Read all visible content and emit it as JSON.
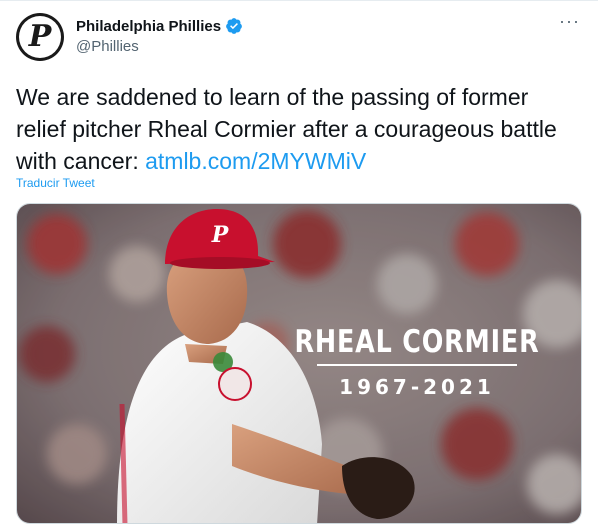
{
  "account": {
    "display_name": "Philadelphia Phillies",
    "handle": "@Phillies",
    "avatar_letter": "P",
    "verified": true
  },
  "tweet": {
    "text": "We are saddened to learn of the passing of former relief pitcher Rheal Cormier after a courageous battle with cancer:",
    "link": "atmlb.com/2MYWMiV",
    "translate_label": "Traducir Tweet"
  },
  "media": {
    "overlay_name": "RHEAL CORMIER",
    "overlay_years": "1967-2021",
    "cap_logo_letter": "P"
  },
  "menu": {
    "more_label": "···"
  },
  "colors": {
    "link": "#1d9bf0",
    "phillies_red": "#c8102e",
    "text": "#0f1419",
    "secondary": "#536471"
  }
}
